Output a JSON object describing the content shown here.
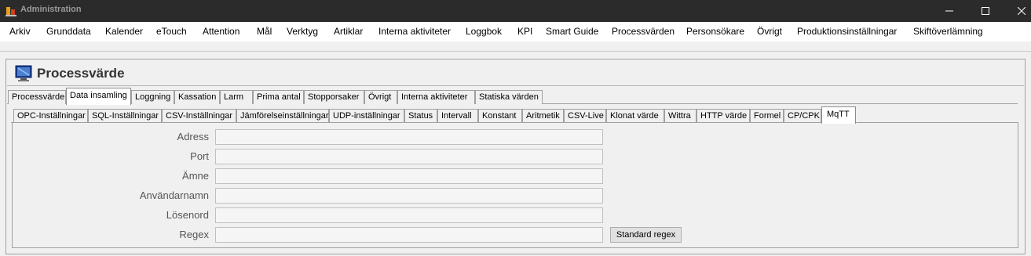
{
  "window": {
    "title": "Administration",
    "icon": "app-logo-icon"
  },
  "window_controls": [
    "minimize-icon",
    "maximize-icon",
    "close-icon"
  ],
  "menu": {
    "items": [
      "Arkiv",
      "Grunddata",
      "Kalender",
      "eTouch",
      "Attention",
      "Mål",
      "Verktyg",
      "Artiklar",
      "Interna aktiviteter",
      "Loggbok",
      "KPI",
      "Smart Guide",
      "Processvärden",
      "Personsökare",
      "Övrigt",
      "Produktionsinställningar",
      "Skiftöverlämning"
    ]
  },
  "header": {
    "title": "Processvärde",
    "icon": "monitor-icon"
  },
  "main_tabs": {
    "items": [
      "Processvärde",
      "Data insamling",
      "Loggning",
      "Kassation",
      "Larm",
      "Prima antal",
      "Stopporsaker",
      "Övrigt",
      "Interna aktiviteter",
      "Statiska värden"
    ],
    "active": "Data insamling"
  },
  "sub_tabs": {
    "items": [
      "OPC-Inställningar",
      "SQL-Inställningar",
      "CSV-Inställningar",
      "Jämförelseinställningar",
      "UDP-inställningar",
      "Status",
      "Intervall",
      "Konstant",
      "Aritmetik",
      "CSV-Live",
      "Klonat värde",
      "Wittra",
      "HTTP värde",
      "Formel",
      "CP/CPK",
      "MqTT"
    ],
    "active": "MqTT"
  },
  "form": {
    "labels": [
      "Adress",
      "Port",
      "Ämne",
      "Användarnamn",
      "Lösenord",
      "Regex"
    ],
    "values": [
      "",
      "",
      "",
      "",
      "",
      ""
    ],
    "regex_button": "Standard regex"
  }
}
